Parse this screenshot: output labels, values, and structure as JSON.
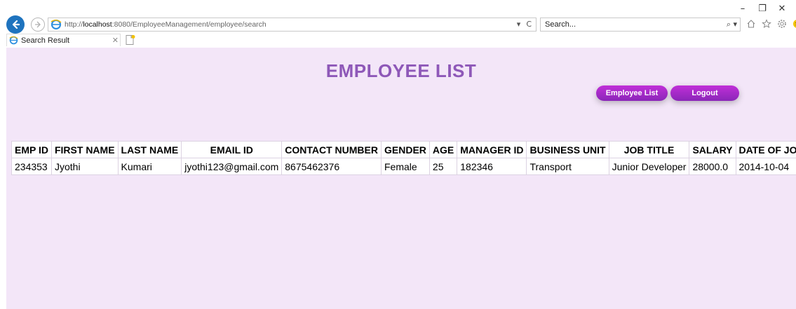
{
  "browser": {
    "url_prefix": "http://",
    "url_host": "localhost",
    "url_path": ":8080/EmployeeManagement/employee/search",
    "search_placeholder": "Search...",
    "tab_title": "Search Result",
    "minimize": "–",
    "restore": "❐",
    "close": "✕",
    "addr_dropdown": "▾",
    "addr_refresh": "C",
    "search_button": "⌕ ▾"
  },
  "page": {
    "title": "EMPLOYEE LIST",
    "buttons": {
      "employee_list": "Employee List",
      "logout": "Logout"
    }
  },
  "table": {
    "headers": [
      "EMP ID",
      "FIRST NAME",
      "LAST NAME",
      "EMAIL ID",
      "CONTACT NUMBER",
      "GENDER",
      "AGE",
      "MANAGER ID",
      "BUSINESS UNIT",
      "JOB TITLE",
      "SALARY",
      "DATE OF JOINING"
    ],
    "rows": [
      [
        "234353",
        "Jyothi",
        "Kumari",
        "jyothi123@gmail.com",
        "8675462376",
        "Female",
        "25",
        "182346",
        "Transport",
        "Junior Developer",
        "28000.0",
        "2014-10-04"
      ]
    ]
  },
  "colors": {
    "background": "#f3e6f8",
    "title": "#8e58b8",
    "button": "#a52bc8"
  }
}
